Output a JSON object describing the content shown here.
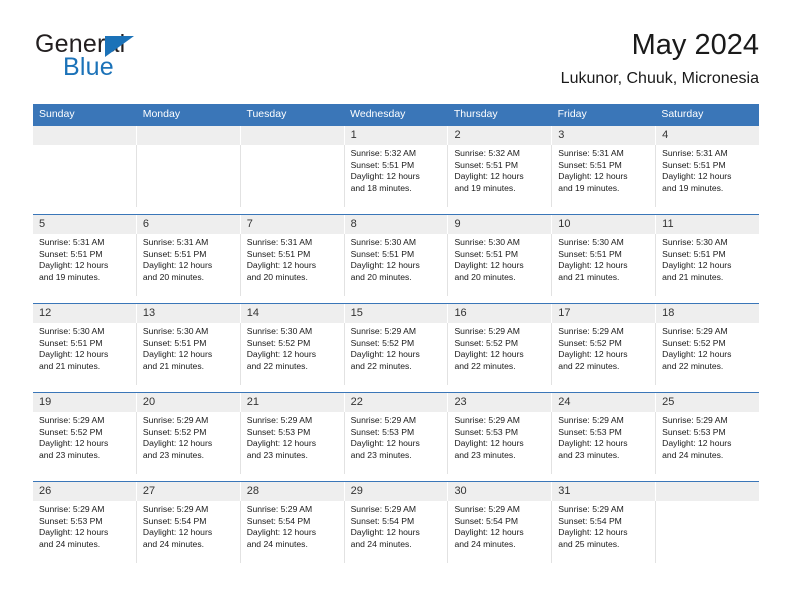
{
  "brand": {
    "name_top": "General",
    "name_bottom": "Blue",
    "color_primary": "#1b72b8",
    "color_text": "#231f20"
  },
  "header": {
    "title": "May 2024",
    "subtitle": "Lukunor, Chuuk, Micronesia"
  },
  "theme": {
    "header_blue": "#3a76b8",
    "daynum_band": "#eeeeee",
    "row_rule": "#3a76b8"
  },
  "weekdays": [
    "Sunday",
    "Monday",
    "Tuesday",
    "Wednesday",
    "Thursday",
    "Friday",
    "Saturday"
  ],
  "weeks": [
    {
      "days": [
        {
          "num": "",
          "empty": true,
          "sunrise": "",
          "sunset": "",
          "daylight1": "",
          "daylight2": ""
        },
        {
          "num": "",
          "empty": true,
          "sunrise": "",
          "sunset": "",
          "daylight1": "",
          "daylight2": ""
        },
        {
          "num": "",
          "empty": true,
          "sunrise": "",
          "sunset": "",
          "daylight1": "",
          "daylight2": ""
        },
        {
          "num": "1",
          "empty": false,
          "sunrise": "Sunrise: 5:32 AM",
          "sunset": "Sunset: 5:51 PM",
          "daylight1": "Daylight: 12 hours",
          "daylight2": "and 18 minutes."
        },
        {
          "num": "2",
          "empty": false,
          "sunrise": "Sunrise: 5:32 AM",
          "sunset": "Sunset: 5:51 PM",
          "daylight1": "Daylight: 12 hours",
          "daylight2": "and 19 minutes."
        },
        {
          "num": "3",
          "empty": false,
          "sunrise": "Sunrise: 5:31 AM",
          "sunset": "Sunset: 5:51 PM",
          "daylight1": "Daylight: 12 hours",
          "daylight2": "and 19 minutes."
        },
        {
          "num": "4",
          "empty": false,
          "sunrise": "Sunrise: 5:31 AM",
          "sunset": "Sunset: 5:51 PM",
          "daylight1": "Daylight: 12 hours",
          "daylight2": "and 19 minutes."
        }
      ]
    },
    {
      "days": [
        {
          "num": "5",
          "empty": false,
          "sunrise": "Sunrise: 5:31 AM",
          "sunset": "Sunset: 5:51 PM",
          "daylight1": "Daylight: 12 hours",
          "daylight2": "and 19 minutes."
        },
        {
          "num": "6",
          "empty": false,
          "sunrise": "Sunrise: 5:31 AM",
          "sunset": "Sunset: 5:51 PM",
          "daylight1": "Daylight: 12 hours",
          "daylight2": "and 20 minutes."
        },
        {
          "num": "7",
          "empty": false,
          "sunrise": "Sunrise: 5:31 AM",
          "sunset": "Sunset: 5:51 PM",
          "daylight1": "Daylight: 12 hours",
          "daylight2": "and 20 minutes."
        },
        {
          "num": "8",
          "empty": false,
          "sunrise": "Sunrise: 5:30 AM",
          "sunset": "Sunset: 5:51 PM",
          "daylight1": "Daylight: 12 hours",
          "daylight2": "and 20 minutes."
        },
        {
          "num": "9",
          "empty": false,
          "sunrise": "Sunrise: 5:30 AM",
          "sunset": "Sunset: 5:51 PM",
          "daylight1": "Daylight: 12 hours",
          "daylight2": "and 20 minutes."
        },
        {
          "num": "10",
          "empty": false,
          "sunrise": "Sunrise: 5:30 AM",
          "sunset": "Sunset: 5:51 PM",
          "daylight1": "Daylight: 12 hours",
          "daylight2": "and 21 minutes."
        },
        {
          "num": "11",
          "empty": false,
          "sunrise": "Sunrise: 5:30 AM",
          "sunset": "Sunset: 5:51 PM",
          "daylight1": "Daylight: 12 hours",
          "daylight2": "and 21 minutes."
        }
      ]
    },
    {
      "days": [
        {
          "num": "12",
          "empty": false,
          "sunrise": "Sunrise: 5:30 AM",
          "sunset": "Sunset: 5:51 PM",
          "daylight1": "Daylight: 12 hours",
          "daylight2": "and 21 minutes."
        },
        {
          "num": "13",
          "empty": false,
          "sunrise": "Sunrise: 5:30 AM",
          "sunset": "Sunset: 5:51 PM",
          "daylight1": "Daylight: 12 hours",
          "daylight2": "and 21 minutes."
        },
        {
          "num": "14",
          "empty": false,
          "sunrise": "Sunrise: 5:30 AM",
          "sunset": "Sunset: 5:52 PM",
          "daylight1": "Daylight: 12 hours",
          "daylight2": "and 22 minutes."
        },
        {
          "num": "15",
          "empty": false,
          "sunrise": "Sunrise: 5:29 AM",
          "sunset": "Sunset: 5:52 PM",
          "daylight1": "Daylight: 12 hours",
          "daylight2": "and 22 minutes."
        },
        {
          "num": "16",
          "empty": false,
          "sunrise": "Sunrise: 5:29 AM",
          "sunset": "Sunset: 5:52 PM",
          "daylight1": "Daylight: 12 hours",
          "daylight2": "and 22 minutes."
        },
        {
          "num": "17",
          "empty": false,
          "sunrise": "Sunrise: 5:29 AM",
          "sunset": "Sunset: 5:52 PM",
          "daylight1": "Daylight: 12 hours",
          "daylight2": "and 22 minutes."
        },
        {
          "num": "18",
          "empty": false,
          "sunrise": "Sunrise: 5:29 AM",
          "sunset": "Sunset: 5:52 PM",
          "daylight1": "Daylight: 12 hours",
          "daylight2": "and 22 minutes."
        }
      ]
    },
    {
      "days": [
        {
          "num": "19",
          "empty": false,
          "sunrise": "Sunrise: 5:29 AM",
          "sunset": "Sunset: 5:52 PM",
          "daylight1": "Daylight: 12 hours",
          "daylight2": "and 23 minutes."
        },
        {
          "num": "20",
          "empty": false,
          "sunrise": "Sunrise: 5:29 AM",
          "sunset": "Sunset: 5:52 PM",
          "daylight1": "Daylight: 12 hours",
          "daylight2": "and 23 minutes."
        },
        {
          "num": "21",
          "empty": false,
          "sunrise": "Sunrise: 5:29 AM",
          "sunset": "Sunset: 5:53 PM",
          "daylight1": "Daylight: 12 hours",
          "daylight2": "and 23 minutes."
        },
        {
          "num": "22",
          "empty": false,
          "sunrise": "Sunrise: 5:29 AM",
          "sunset": "Sunset: 5:53 PM",
          "daylight1": "Daylight: 12 hours",
          "daylight2": "and 23 minutes."
        },
        {
          "num": "23",
          "empty": false,
          "sunrise": "Sunrise: 5:29 AM",
          "sunset": "Sunset: 5:53 PM",
          "daylight1": "Daylight: 12 hours",
          "daylight2": "and 23 minutes."
        },
        {
          "num": "24",
          "empty": false,
          "sunrise": "Sunrise: 5:29 AM",
          "sunset": "Sunset: 5:53 PM",
          "daylight1": "Daylight: 12 hours",
          "daylight2": "and 23 minutes."
        },
        {
          "num": "25",
          "empty": false,
          "sunrise": "Sunrise: 5:29 AM",
          "sunset": "Sunset: 5:53 PM",
          "daylight1": "Daylight: 12 hours",
          "daylight2": "and 24 minutes."
        }
      ]
    },
    {
      "days": [
        {
          "num": "26",
          "empty": false,
          "sunrise": "Sunrise: 5:29 AM",
          "sunset": "Sunset: 5:53 PM",
          "daylight1": "Daylight: 12 hours",
          "daylight2": "and 24 minutes."
        },
        {
          "num": "27",
          "empty": false,
          "sunrise": "Sunrise: 5:29 AM",
          "sunset": "Sunset: 5:54 PM",
          "daylight1": "Daylight: 12 hours",
          "daylight2": "and 24 minutes."
        },
        {
          "num": "28",
          "empty": false,
          "sunrise": "Sunrise: 5:29 AM",
          "sunset": "Sunset: 5:54 PM",
          "daylight1": "Daylight: 12 hours",
          "daylight2": "and 24 minutes."
        },
        {
          "num": "29",
          "empty": false,
          "sunrise": "Sunrise: 5:29 AM",
          "sunset": "Sunset: 5:54 PM",
          "daylight1": "Daylight: 12 hours",
          "daylight2": "and 24 minutes."
        },
        {
          "num": "30",
          "empty": false,
          "sunrise": "Sunrise: 5:29 AM",
          "sunset": "Sunset: 5:54 PM",
          "daylight1": "Daylight: 12 hours",
          "daylight2": "and 24 minutes."
        },
        {
          "num": "31",
          "empty": false,
          "sunrise": "Sunrise: 5:29 AM",
          "sunset": "Sunset: 5:54 PM",
          "daylight1": "Daylight: 12 hours",
          "daylight2": "and 25 minutes."
        },
        {
          "num": "",
          "empty": true,
          "sunrise": "",
          "sunset": "",
          "daylight1": "",
          "daylight2": ""
        }
      ]
    }
  ]
}
